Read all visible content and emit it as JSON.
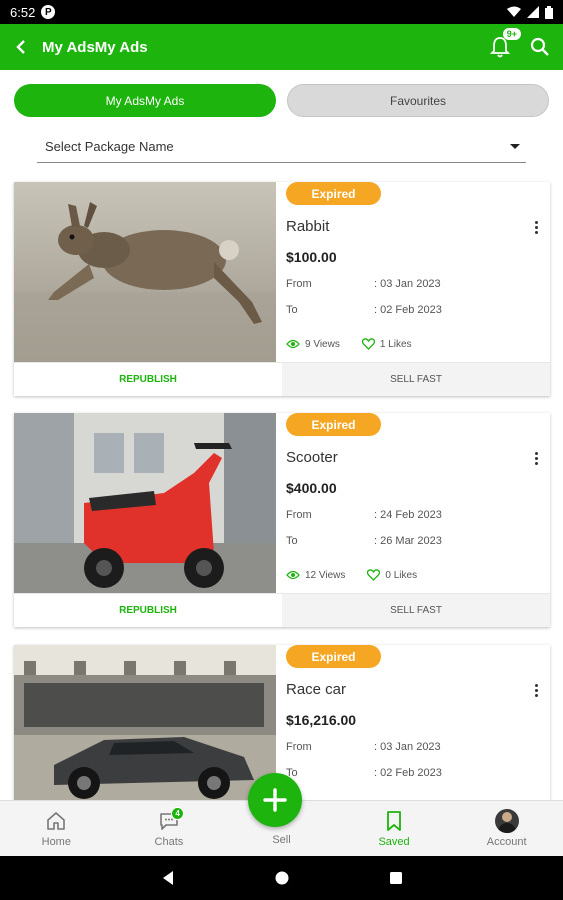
{
  "status_bar": {
    "time": "6:52",
    "app_icon": "P"
  },
  "app_bar": {
    "title": "My AdsMy Ads",
    "notification_badge": "9+"
  },
  "tabs": {
    "active": "My AdsMy Ads",
    "inactive": "Favourites"
  },
  "select": {
    "placeholder": "Select Package Name"
  },
  "ads": [
    {
      "status": "Expired",
      "title": "Rabbit",
      "price": "$100.00",
      "from_label": "From",
      "from": ": 03 Jan 2023",
      "to_label": "To",
      "to": ": 02 Feb 2023",
      "views": "9 Views",
      "likes": "1 Likes",
      "republish": "REPUBLISH",
      "sell_fast": "SELL FAST"
    },
    {
      "status": "Expired",
      "title": "Scooter",
      "price": "$400.00",
      "from_label": "From",
      "from": ": 24 Feb 2023",
      "to_label": "To",
      "to": ": 26 Mar 2023",
      "views": "12 Views",
      "likes": "0 Likes",
      "republish": "REPUBLISH",
      "sell_fast": "SELL FAST"
    },
    {
      "status": "Expired",
      "title": "Race car",
      "price": "$16,216.00",
      "from_label": "From",
      "from": ": 03 Jan 2023",
      "to_label": "To",
      "to": ": 02 Feb 2023"
    }
  ],
  "bottom_nav": {
    "home": "Home",
    "chats": "Chats",
    "chats_badge": "4",
    "sell": "Sell",
    "saved": "Saved",
    "account": "Account"
  },
  "colors": {
    "primary": "#1db40d",
    "expired": "#f5a623"
  },
  "icons": [
    "back-arrow-icon",
    "bell-icon",
    "search-icon",
    "eye-icon",
    "heart-icon",
    "kebab-menu-icon",
    "home-icon",
    "chat-icon",
    "plus-icon",
    "bookmark-icon",
    "avatar"
  ]
}
